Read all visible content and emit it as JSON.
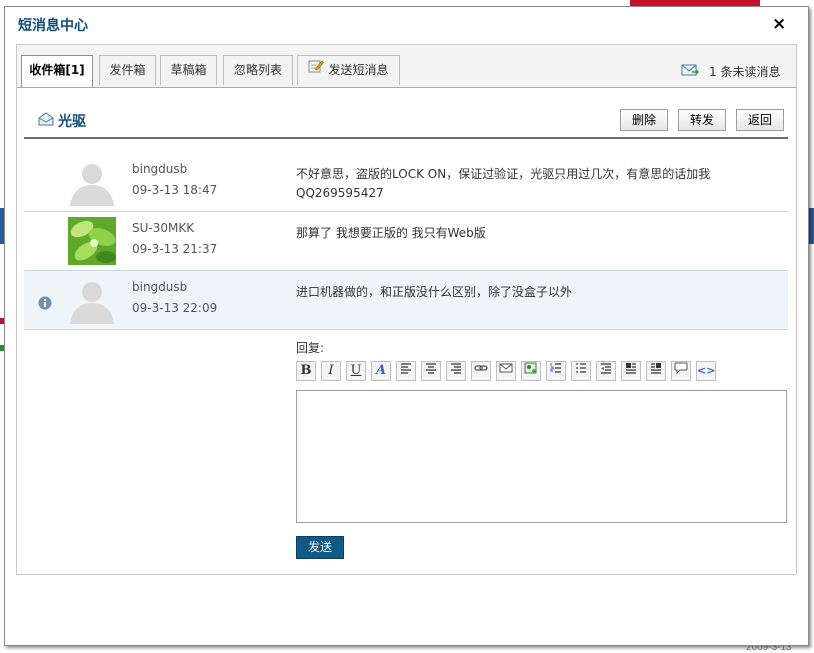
{
  "dialog": {
    "title": "短消息中心",
    "close_label": "×"
  },
  "tabs": [
    {
      "label": "收件箱[1]",
      "active": true
    },
    {
      "label": "发件箱",
      "active": false
    },
    {
      "label": "草稿箱",
      "active": false
    },
    {
      "label": "忽略列表",
      "active": false
    },
    {
      "label": "发送短消息",
      "active": false,
      "icon": "edit-icon"
    }
  ],
  "unread": {
    "text": "1  条未读消息",
    "icon": "mail-arrow-icon"
  },
  "conversation": {
    "contact_name": "光驱",
    "contact_icon": "envelope-icon",
    "buttons": {
      "delete": "删除",
      "forward": "转发",
      "back": "返回"
    }
  },
  "messages": [
    {
      "sender": "bingdusb",
      "time": "09-3-13 18:47",
      "text": "不好意思，盗版的LOCK ON，保证过验证，光驱只用过几次，有意思的话加我QQ269595427",
      "avatar": "default-avatar-icon",
      "highlighted": false
    },
    {
      "sender": "SU-30MKK",
      "time": "09-3-13 21:37",
      "text": "那算了 我想要正版的 我只有Web版",
      "avatar": "leaf-photo-avatar",
      "highlighted": false
    },
    {
      "sender": "bingdusb",
      "time": "09-3-13 22:09",
      "text": "进口机器做的，和正版没什么区别，除了没盒子以外",
      "avatar": "default-avatar-icon",
      "highlighted": true,
      "status_icon": "info-icon"
    }
  ],
  "reply": {
    "label": "回复:",
    "value": "",
    "send_label": "发送",
    "toolbar": [
      "bold-icon",
      "italic-icon",
      "underline-icon",
      "font-color-icon",
      "align-left-icon",
      "align-center-icon",
      "align-right-icon",
      "link-icon",
      "email-icon",
      "image-icon",
      "ordered-list-icon",
      "unordered-list-icon",
      "outdent-icon",
      "float-left-icon",
      "float-right-icon",
      "quote-icon",
      "code-icon"
    ]
  },
  "background_page": {
    "date_fragment": "2009-3-13"
  },
  "colors": {
    "title": "#0f4d77",
    "send_button": "#0f5a87",
    "row_highlight": "#eef4f7"
  }
}
